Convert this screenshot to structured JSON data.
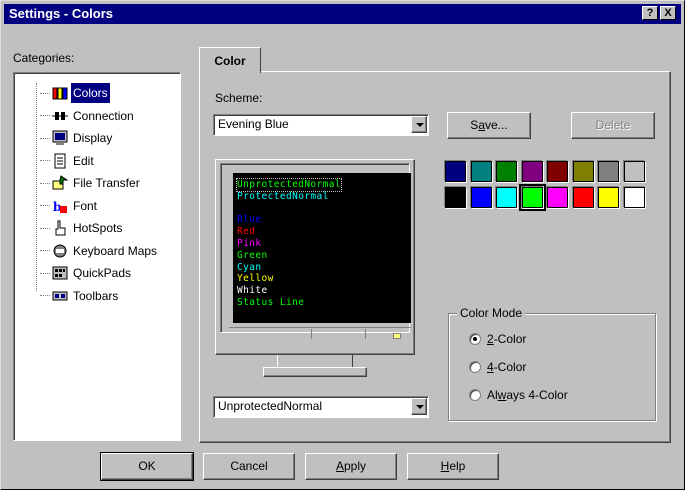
{
  "window": {
    "title": "Settings - Colors",
    "help_btn": "?",
    "close_btn": "X"
  },
  "categories": {
    "label": "Categories:",
    "items": [
      {
        "label": "Colors",
        "icon": "colors-icon",
        "selected": true
      },
      {
        "label": "Connection",
        "icon": "connection-icon"
      },
      {
        "label": "Display",
        "icon": "display-icon"
      },
      {
        "label": "Edit",
        "icon": "edit-icon"
      },
      {
        "label": "File Transfer",
        "icon": "file-transfer-icon"
      },
      {
        "label": "Font",
        "icon": "font-icon"
      },
      {
        "label": "HotSpots",
        "icon": "hotspots-icon"
      },
      {
        "label": "Keyboard Maps",
        "icon": "keyboard-maps-icon"
      },
      {
        "label": "QuickPads",
        "icon": "quickpads-icon"
      },
      {
        "label": "Toolbars",
        "icon": "toolbars-icon"
      }
    ]
  },
  "tab": {
    "label": "Color"
  },
  "scheme": {
    "label": "Scheme:",
    "value": "Evening Blue",
    "save_label": "Save...",
    "delete_label": "Delete"
  },
  "preview": {
    "lines": [
      {
        "text": "UnprotectedNormal",
        "color": "#00ff00",
        "dotted": true
      },
      {
        "text": "ProtectedNormal",
        "color": "#00ffff"
      },
      {
        "text": "",
        "color": "#000000"
      },
      {
        "text": "Blue",
        "color": "#0000ff"
      },
      {
        "text": "Red",
        "color": "#ff0000"
      },
      {
        "text": "Pink",
        "color": "#ff00ff"
      },
      {
        "text": "Green",
        "color": "#00ff00"
      },
      {
        "text": "Cyan",
        "color": "#00ffff"
      },
      {
        "text": "Yellow",
        "color": "#ffff00"
      },
      {
        "text": "White",
        "color": "#ffffff"
      },
      {
        "text": "Status Line",
        "color": "#00ff00"
      }
    ]
  },
  "element_select": {
    "value": "UnprotectedNormal"
  },
  "palette": {
    "row1": [
      "#000080",
      "#008080",
      "#008000",
      "#800080",
      "#800000",
      "#808000",
      "#808080",
      "#c0c0c0"
    ],
    "row2": [
      "#000000",
      "#0000ff",
      "#00ffff",
      "#00ff00",
      "#ff00ff",
      "#ff0000",
      "#ffff00",
      "#ffffff"
    ],
    "selected": "#00ff00"
  },
  "color_mode": {
    "label": "Color Mode",
    "options": [
      {
        "pre": "",
        "acc": "2",
        "post": "-Color",
        "checked": true
      },
      {
        "pre": "",
        "acc": "4",
        "post": "-Color",
        "checked": false
      },
      {
        "pre": "Al",
        "acc": "w",
        "post": "ays 4-Color",
        "checked": false
      }
    ]
  },
  "buttons": {
    "ok": "OK",
    "cancel": "Cancel",
    "apply": "Apply",
    "help": "Help"
  }
}
